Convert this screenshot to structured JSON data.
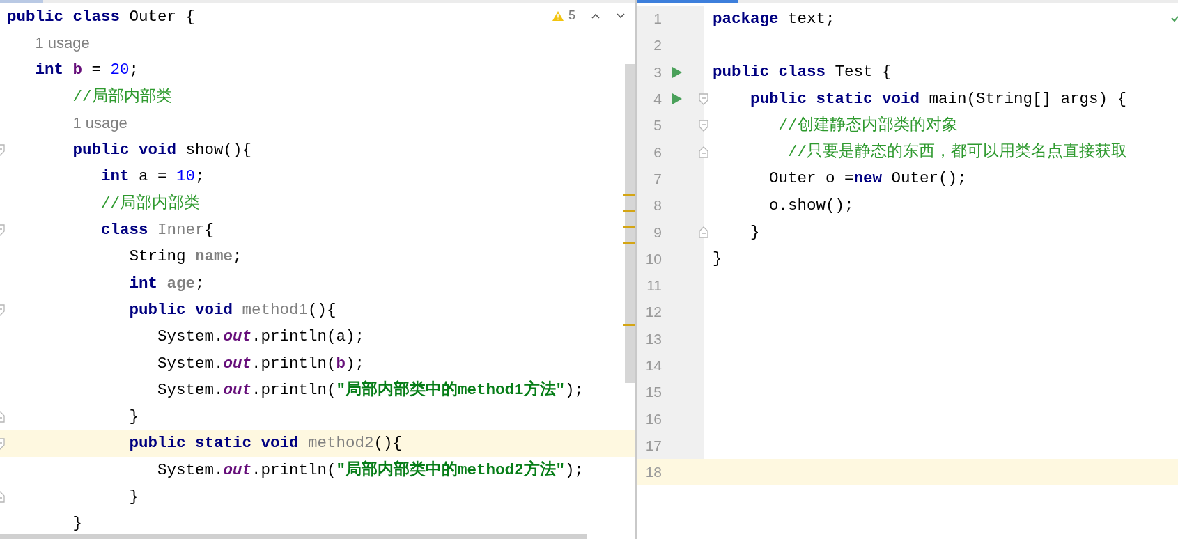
{
  "left_editor": {
    "inspection": {
      "count": "5"
    },
    "lines": [
      {
        "kind": "code",
        "current": false,
        "tokens": [
          {
            "text": "public class ",
            "kind": "keyword"
          },
          {
            "text": "Outer {",
            "kind": "plain"
          }
        ]
      },
      {
        "kind": "hint",
        "text": "   1 usage"
      },
      {
        "kind": "code",
        "current": false,
        "tokens": [
          {
            "text": "   int ",
            "kind": "keyword"
          },
          {
            "text": "b",
            "kind": "field"
          },
          {
            "text": " = ",
            "kind": "plain"
          },
          {
            "text": "20",
            "kind": "number"
          },
          {
            "text": ";",
            "kind": "plain"
          }
        ]
      },
      {
        "kind": "code",
        "current": false,
        "tokens": [
          {
            "text": "       //局部内部类",
            "kind": "comment"
          }
        ]
      },
      {
        "kind": "hint",
        "text": "       1 usage"
      },
      {
        "kind": "code",
        "current": false,
        "fold": {
          "kind": "open"
        },
        "tokens": [
          {
            "text": "       public void",
            "kind": "keyword"
          },
          {
            "text": " show(){",
            "kind": "plain"
          }
        ]
      },
      {
        "kind": "code",
        "current": false,
        "tokens": [
          {
            "text": "          int",
            "kind": "keyword"
          },
          {
            "text": " a = ",
            "kind": "plain"
          },
          {
            "text": "10",
            "kind": "number"
          },
          {
            "text": ";",
            "kind": "plain"
          }
        ]
      },
      {
        "kind": "code",
        "current": false,
        "tokens": [
          {
            "text": "          //局部内部类",
            "kind": "comment"
          }
        ]
      },
      {
        "kind": "code",
        "current": false,
        "fold": {
          "kind": "open"
        },
        "tokens": [
          {
            "text": "          class ",
            "kind": "keyword"
          },
          {
            "text": "Inner",
            "kind": "unused"
          },
          {
            "text": "{",
            "kind": "plain"
          }
        ]
      },
      {
        "kind": "code",
        "current": false,
        "tokens": [
          {
            "text": "             String ",
            "kind": "plain"
          },
          {
            "text": "name",
            "kind": "unused_field"
          },
          {
            "text": ";",
            "kind": "plain"
          }
        ]
      },
      {
        "kind": "code",
        "current": false,
        "tokens": [
          {
            "text": "             int ",
            "kind": "keyword"
          },
          {
            "text": "age",
            "kind": "unused_field"
          },
          {
            "text": ";",
            "kind": "plain"
          }
        ]
      },
      {
        "kind": "code",
        "current": false,
        "fold": {
          "kind": "open"
        },
        "tokens": [
          {
            "text": "             public void ",
            "kind": "keyword"
          },
          {
            "text": "method1",
            "kind": "unused"
          },
          {
            "text": "(){",
            "kind": "plain"
          }
        ]
      },
      {
        "kind": "code",
        "current": false,
        "tokens": [
          {
            "text": "                System.",
            "kind": "plain"
          },
          {
            "text": "out",
            "kind": "static_field"
          },
          {
            "text": ".println(a);",
            "kind": "plain"
          }
        ]
      },
      {
        "kind": "code",
        "current": false,
        "tokens": [
          {
            "text": "                System.",
            "kind": "plain"
          },
          {
            "text": "out",
            "kind": "static_field"
          },
          {
            "text": ".println(",
            "kind": "plain"
          },
          {
            "text": "b",
            "kind": "field"
          },
          {
            "text": ");",
            "kind": "plain"
          }
        ]
      },
      {
        "kind": "code",
        "current": false,
        "tokens": [
          {
            "text": "                System.",
            "kind": "plain"
          },
          {
            "text": "out",
            "kind": "static_field"
          },
          {
            "text": ".println(",
            "kind": "plain"
          },
          {
            "text": "\"局部内部类中的method1方法\"",
            "kind": "string"
          },
          {
            "text": ");",
            "kind": "plain"
          }
        ]
      },
      {
        "kind": "code",
        "current": false,
        "fold": {
          "kind": "close"
        },
        "tokens": [
          {
            "text": "             }",
            "kind": "plain"
          }
        ]
      },
      {
        "kind": "code",
        "current": true,
        "fold": {
          "kind": "open"
        },
        "tokens": [
          {
            "text": "             public static void ",
            "kind": "keyword"
          },
          {
            "text": "method2",
            "kind": "unused"
          },
          {
            "text": "(){",
            "kind": "plain"
          }
        ]
      },
      {
        "kind": "code",
        "current": false,
        "tokens": [
          {
            "text": "                System.",
            "kind": "plain"
          },
          {
            "text": "out",
            "kind": "static_field"
          },
          {
            "text": ".println(",
            "kind": "plain"
          },
          {
            "text": "\"局部内部类中的method2方法\"",
            "kind": "string"
          },
          {
            "text": ");",
            "kind": "plain"
          }
        ]
      },
      {
        "kind": "code",
        "current": false,
        "fold": {
          "kind": "close"
        },
        "tokens": [
          {
            "text": "             }",
            "kind": "plain"
          }
        ]
      },
      {
        "kind": "code",
        "current": false,
        "tokens": [
          {
            "text": "       }",
            "kind": "plain"
          }
        ]
      }
    ]
  },
  "right_editor": {
    "lines": [
      {
        "number": "1",
        "runnable": false,
        "current": false,
        "tokens": [
          {
            "text": "package",
            "kind": "keyword"
          },
          {
            "text": " text;",
            "kind": "plain"
          }
        ]
      },
      {
        "number": "2",
        "runnable": false,
        "current": false
      },
      {
        "number": "3",
        "runnable": true,
        "current": false,
        "tokens": [
          {
            "text": "public class",
            "kind": "keyword"
          },
          {
            "text": " Test {",
            "kind": "plain"
          }
        ]
      },
      {
        "number": "4",
        "runnable": true,
        "current": false,
        "fold": {
          "kind": "open"
        },
        "tokens": [
          {
            "text": "    public static void",
            "kind": "keyword"
          },
          {
            "text": " main(String[] args) {",
            "kind": "plain"
          }
        ]
      },
      {
        "number": "5",
        "runnable": false,
        "current": false,
        "fold": {
          "kind": "open"
        },
        "tokens": [
          {
            "text": "       //创建静态内部类的对象",
            "kind": "comment"
          }
        ]
      },
      {
        "number": "6",
        "runnable": false,
        "current": false,
        "fold": {
          "kind": "close"
        },
        "tokens": [
          {
            "text": "        //只要是静态的东西，都可以用类名点直接获取",
            "kind": "comment"
          }
        ]
      },
      {
        "number": "7",
        "runnable": false,
        "current": false,
        "tokens": [
          {
            "text": "      Outer o =",
            "kind": "plain"
          },
          {
            "text": "new",
            "kind": "keyword"
          },
          {
            "text": " Outer();",
            "kind": "plain"
          }
        ]
      },
      {
        "number": "8",
        "runnable": false,
        "current": false,
        "tokens": [
          {
            "text": "      o.show();",
            "kind": "plain"
          }
        ]
      },
      {
        "number": "9",
        "runnable": false,
        "current": false,
        "fold": {
          "kind": "close"
        },
        "tokens": [
          {
            "text": "    }",
            "kind": "plain"
          }
        ]
      },
      {
        "number": "10",
        "runnable": false,
        "current": false,
        "tokens": [
          {
            "text": "}",
            "kind": "plain"
          }
        ]
      },
      {
        "number": "11",
        "runnable": false,
        "current": false
      },
      {
        "number": "12",
        "runnable": false,
        "current": false
      },
      {
        "number": "13",
        "runnable": false,
        "current": false
      },
      {
        "number": "14",
        "runnable": false,
        "current": false
      },
      {
        "number": "15",
        "runnable": false,
        "current": false
      },
      {
        "number": "16",
        "runnable": false,
        "current": false
      },
      {
        "number": "17",
        "runnable": false,
        "current": false
      },
      {
        "number": "18",
        "runnable": false,
        "current": true
      }
    ]
  }
}
